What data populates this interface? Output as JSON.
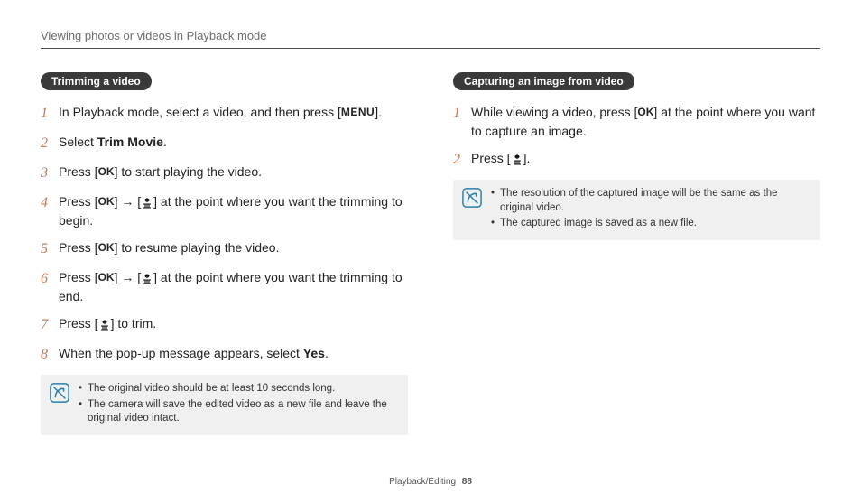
{
  "header": "Viewing photos or videos in Playback mode",
  "left": {
    "title": "Trimming a video",
    "steps": [
      {
        "num": "1",
        "parts": [
          {
            "t": "text",
            "v": "In Playback mode, select a video, and then press ["
          },
          {
            "t": "menu"
          },
          {
            "t": "text",
            "v": "]."
          }
        ]
      },
      {
        "num": "2",
        "parts": [
          {
            "t": "text",
            "v": "Select "
          },
          {
            "t": "bold",
            "v": "Trim Movie"
          },
          {
            "t": "text",
            "v": "."
          }
        ]
      },
      {
        "num": "3",
        "parts": [
          {
            "t": "text",
            "v": "Press ["
          },
          {
            "t": "ok"
          },
          {
            "t": "text",
            "v": "] to start playing the video."
          }
        ]
      },
      {
        "num": "4",
        "parts": [
          {
            "t": "text",
            "v": "Press ["
          },
          {
            "t": "ok"
          },
          {
            "t": "text",
            "v": "] → ["
          },
          {
            "t": "macro"
          },
          {
            "t": "text",
            "v": "] at the point where you want the trimming to begin."
          }
        ]
      },
      {
        "num": "5",
        "parts": [
          {
            "t": "text",
            "v": "Press ["
          },
          {
            "t": "ok"
          },
          {
            "t": "text",
            "v": "] to resume playing the video."
          }
        ]
      },
      {
        "num": "6",
        "parts": [
          {
            "t": "text",
            "v": "Press ["
          },
          {
            "t": "ok"
          },
          {
            "t": "text",
            "v": "] → ["
          },
          {
            "t": "macro"
          },
          {
            "t": "text",
            "v": "] at the point where you want the trimming to end."
          }
        ]
      },
      {
        "num": "7",
        "parts": [
          {
            "t": "text",
            "v": "Press ["
          },
          {
            "t": "macro"
          },
          {
            "t": "text",
            "v": "] to trim."
          }
        ]
      },
      {
        "num": "8",
        "parts": [
          {
            "t": "text",
            "v": "When the pop-up message appears, select "
          },
          {
            "t": "bold",
            "v": "Yes"
          },
          {
            "t": "text",
            "v": "."
          }
        ]
      }
    ],
    "notes": [
      "The original video should be at least 10 seconds long.",
      "The camera will save the edited video as a new file and leave the original video intact."
    ]
  },
  "right": {
    "title": "Capturing an image from video",
    "steps": [
      {
        "num": "1",
        "parts": [
          {
            "t": "text",
            "v": "While viewing a video, press ["
          },
          {
            "t": "ok"
          },
          {
            "t": "text",
            "v": "] at the point where you want to capture an image."
          }
        ]
      },
      {
        "num": "2",
        "parts": [
          {
            "t": "text",
            "v": "Press ["
          },
          {
            "t": "macro"
          },
          {
            "t": "text",
            "v": "]."
          }
        ]
      }
    ],
    "notes": [
      "The resolution of the captured image will be the same as the original video.",
      "The captured image is saved as a new file."
    ]
  },
  "footer": {
    "section": "Playback/Editing",
    "page": "88"
  },
  "glyphs": {
    "menu": "MENU",
    "ok": "OK"
  }
}
